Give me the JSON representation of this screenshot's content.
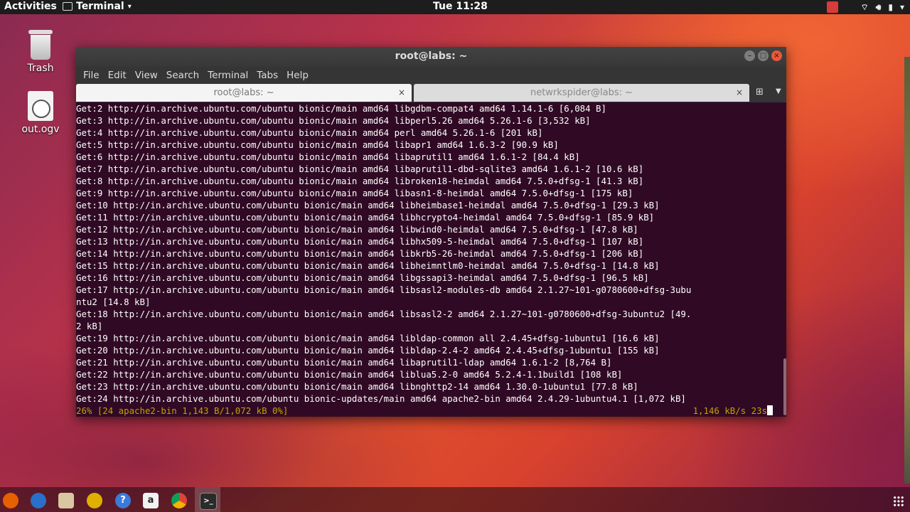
{
  "topbar": {
    "activities": "Activities",
    "app_name": "Terminal",
    "clock": "Tue 11:28"
  },
  "desktop": {
    "icons": [
      {
        "label": "Trash",
        "icon": "trash-icon"
      },
      {
        "label": "out.ogv",
        "icon": "video-file-icon"
      }
    ]
  },
  "window": {
    "title": "root@labs: ~",
    "menu": [
      "File",
      "Edit",
      "View",
      "Search",
      "Terminal",
      "Tabs",
      "Help"
    ],
    "tabs": [
      {
        "label": "root@labs: ~",
        "close": "×",
        "active": true
      },
      {
        "label": "netwrkspider@labs: ~",
        "close": "×",
        "active": false
      }
    ]
  },
  "terminal": {
    "lines": [
      "Get:2 http://in.archive.ubuntu.com/ubuntu bionic/main amd64 libgdbm-compat4 amd64 1.14.1-6 [6,084 B]",
      "Get:3 http://in.archive.ubuntu.com/ubuntu bionic/main amd64 libperl5.26 amd64 5.26.1-6 [3,532 kB]",
      "Get:4 http://in.archive.ubuntu.com/ubuntu bionic/main amd64 perl amd64 5.26.1-6 [201 kB]",
      "Get:5 http://in.archive.ubuntu.com/ubuntu bionic/main amd64 libapr1 amd64 1.6.3-2 [90.9 kB]",
      "Get:6 http://in.archive.ubuntu.com/ubuntu bionic/main amd64 libaprutil1 amd64 1.6.1-2 [84.4 kB]",
      "Get:7 http://in.archive.ubuntu.com/ubuntu bionic/main amd64 libaprutil1-dbd-sqlite3 amd64 1.6.1-2 [10.6 kB]",
      "Get:8 http://in.archive.ubuntu.com/ubuntu bionic/main amd64 libroken18-heimdal amd64 7.5.0+dfsg-1 [41.3 kB]",
      "Get:9 http://in.archive.ubuntu.com/ubuntu bionic/main amd64 libasn1-8-heimdal amd64 7.5.0+dfsg-1 [175 kB]",
      "Get:10 http://in.archive.ubuntu.com/ubuntu bionic/main amd64 libheimbase1-heimdal amd64 7.5.0+dfsg-1 [29.3 kB]",
      "Get:11 http://in.archive.ubuntu.com/ubuntu bionic/main amd64 libhcrypto4-heimdal amd64 7.5.0+dfsg-1 [85.9 kB]",
      "Get:12 http://in.archive.ubuntu.com/ubuntu bionic/main amd64 libwind0-heimdal amd64 7.5.0+dfsg-1 [47.8 kB]",
      "Get:13 http://in.archive.ubuntu.com/ubuntu bionic/main amd64 libhx509-5-heimdal amd64 7.5.0+dfsg-1 [107 kB]",
      "Get:14 http://in.archive.ubuntu.com/ubuntu bionic/main amd64 libkrb5-26-heimdal amd64 7.5.0+dfsg-1 [206 kB]",
      "Get:15 http://in.archive.ubuntu.com/ubuntu bionic/main amd64 libheimntlm0-heimdal amd64 7.5.0+dfsg-1 [14.8 kB]",
      "Get:16 http://in.archive.ubuntu.com/ubuntu bionic/main amd64 libgssapi3-heimdal amd64 7.5.0+dfsg-1 [96.5 kB]",
      "Get:17 http://in.archive.ubuntu.com/ubuntu bionic/main amd64 libsasl2-modules-db amd64 2.1.27~101-g0780600+dfsg-3ubu",
      "ntu2 [14.8 kB]",
      "Get:18 http://in.archive.ubuntu.com/ubuntu bionic/main amd64 libsasl2-2 amd64 2.1.27~101-g0780600+dfsg-3ubuntu2 [49.",
      "2 kB]",
      "Get:19 http://in.archive.ubuntu.com/ubuntu bionic/main amd64 libldap-common all 2.4.45+dfsg-1ubuntu1 [16.6 kB]",
      "Get:20 http://in.archive.ubuntu.com/ubuntu bionic/main amd64 libldap-2.4-2 amd64 2.4.45+dfsg-1ubuntu1 [155 kB]",
      "Get:21 http://in.archive.ubuntu.com/ubuntu bionic/main amd64 libaprutil1-ldap amd64 1.6.1-2 [8,764 B]",
      "Get:22 http://in.archive.ubuntu.com/ubuntu bionic/main amd64 liblua5.2-0 amd64 5.2.4-1.1build1 [108 kB]",
      "Get:23 http://in.archive.ubuntu.com/ubuntu bionic/main amd64 libnghttp2-14 amd64 1.30.0-1ubuntu1 [77.8 kB]",
      "Get:24 http://in.archive.ubuntu.com/ubuntu bionic-updates/main amd64 apache2-bin amd64 2.4.29-1ubuntu4.1 [1,072 kB]"
    ],
    "progress_left": "26% [24 apache2-bin 1,143 B/1,072 kB 0%]",
    "progress_right": "1,146 kB/s 23s"
  },
  "dock": {
    "apps": [
      "firefox-icon",
      "thunderbird-icon",
      "files-icon",
      "rhythmbox-icon",
      "help-icon",
      "amazon-icon",
      "chrome-icon",
      "terminal-icon"
    ]
  }
}
